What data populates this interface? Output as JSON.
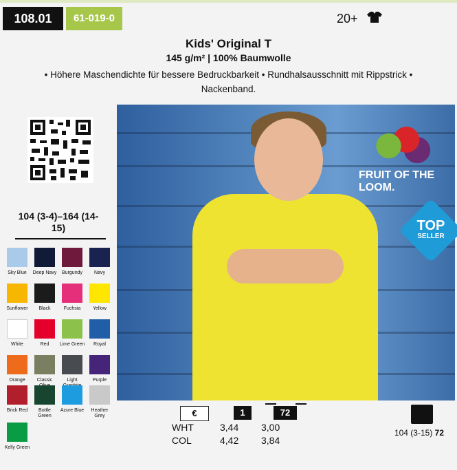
{
  "header": {
    "article_no": "108.01",
    "supplier_no": "61-019-0",
    "wash_icon": "20+",
    "shirt_icon": "t-shirt-icon"
  },
  "product": {
    "title": "Kids' Original T",
    "subtitle": "145 g/m² | 100% Baumwolle",
    "description": "• Höhere Maschendichte für bessere Bedruckbarkeit • Rundhalsausschnitt mit Rippstrick • Nackenband.",
    "sizes": "104 (3-4)–164 (14-15)",
    "brand": "FRUIT OF THE LOOM.",
    "badge_top": "TOP",
    "badge_bottom": "SELLER"
  },
  "colors": [
    {
      "name": "Sky Blue",
      "hex": "#a9cbe9"
    },
    {
      "name": "Deep Navy",
      "hex": "#111a37"
    },
    {
      "name": "Burgundy",
      "hex": "#6f1a3c"
    },
    {
      "name": "Navy",
      "hex": "#1a2350"
    },
    {
      "name": "Sunflower",
      "hex": "#f7b700"
    },
    {
      "name": "Black",
      "hex": "#1b1b1b"
    },
    {
      "name": "Fuchsia",
      "hex": "#e62f7b"
    },
    {
      "name": "Yellow",
      "hex": "#ffe600"
    },
    {
      "name": "White",
      "hex": "#ffffff"
    },
    {
      "name": "Red",
      "hex": "#e4002b"
    },
    {
      "name": "Lime Green",
      "hex": "#8cc24b"
    },
    {
      "name": "Royal",
      "hex": "#205fa8"
    },
    {
      "name": "Orange",
      "hex": "#ed6b1a"
    },
    {
      "name": "Classic Olive",
      "hex": "#7a7f61"
    },
    {
      "name": "Light Graphite",
      "hex": "#484b4f"
    },
    {
      "name": "Purple",
      "hex": "#46247a"
    },
    {
      "name": "Brick Red",
      "hex": "#b01f2b"
    },
    {
      "name": "Bottle Green",
      "hex": "#17452f"
    },
    {
      "name": "Azure Blue",
      "hex": "#1d9ce0"
    },
    {
      "name": "Heather Grey",
      "hex": "#c9c9c9"
    },
    {
      "name": "Kelly Green",
      "hex": "#0a9b45"
    }
  ],
  "pricing": {
    "currency_label": "€",
    "qty_1": "1",
    "qty_72": "72",
    "rows": [
      {
        "label": "WHT",
        "p1": "3,44",
        "p72": "3,00"
      },
      {
        "label": "COL",
        "p1": "4,42",
        "p72": "3,84"
      }
    ]
  },
  "carton": {
    "label": "104 (3-15)",
    "qty": "72"
  }
}
